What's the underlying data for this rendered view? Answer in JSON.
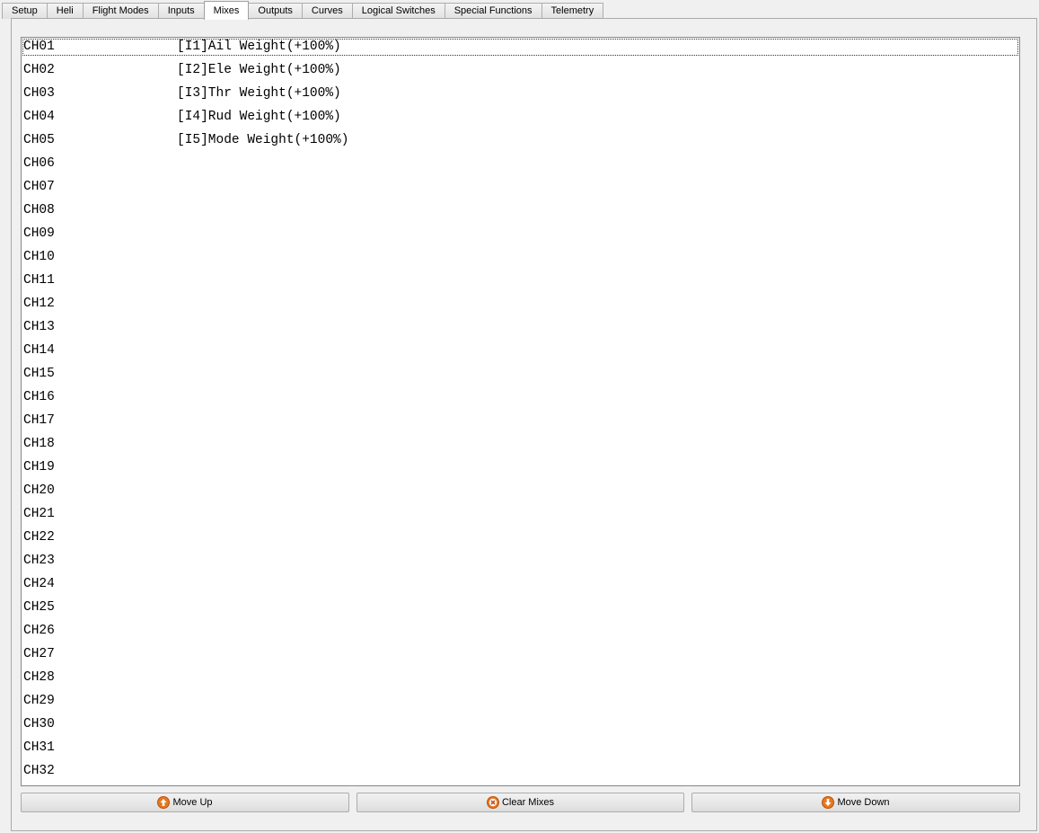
{
  "tabs": [
    "Setup",
    "Heli",
    "Flight Modes",
    "Inputs",
    "Mixes",
    "Outputs",
    "Curves",
    "Logical Switches",
    "Special Functions",
    "Telemetry"
  ],
  "active_tab": "Mixes",
  "mixes": [
    {
      "channel": "CH01",
      "mix": "[I1]Ail Weight(+100%)"
    },
    {
      "channel": "CH02",
      "mix": "[I2]Ele Weight(+100%)"
    },
    {
      "channel": "CH03",
      "mix": "[I3]Thr Weight(+100%)"
    },
    {
      "channel": "CH04",
      "mix": "[I4]Rud Weight(+100%)"
    },
    {
      "channel": "CH05",
      "mix": "[I5]Mode Weight(+100%)"
    },
    {
      "channel": "CH06",
      "mix": ""
    },
    {
      "channel": "CH07",
      "mix": ""
    },
    {
      "channel": "CH08",
      "mix": ""
    },
    {
      "channel": "CH09",
      "mix": ""
    },
    {
      "channel": "CH10",
      "mix": ""
    },
    {
      "channel": "CH11",
      "mix": ""
    },
    {
      "channel": "CH12",
      "mix": ""
    },
    {
      "channel": "CH13",
      "mix": ""
    },
    {
      "channel": "CH14",
      "mix": ""
    },
    {
      "channel": "CH15",
      "mix": ""
    },
    {
      "channel": "CH16",
      "mix": ""
    },
    {
      "channel": "CH17",
      "mix": ""
    },
    {
      "channel": "CH18",
      "mix": ""
    },
    {
      "channel": "CH19",
      "mix": ""
    },
    {
      "channel": "CH20",
      "mix": ""
    },
    {
      "channel": "CH21",
      "mix": ""
    },
    {
      "channel": "CH22",
      "mix": ""
    },
    {
      "channel": "CH23",
      "mix": ""
    },
    {
      "channel": "CH24",
      "mix": ""
    },
    {
      "channel": "CH25",
      "mix": ""
    },
    {
      "channel": "CH26",
      "mix": ""
    },
    {
      "channel": "CH27",
      "mix": ""
    },
    {
      "channel": "CH28",
      "mix": ""
    },
    {
      "channel": "CH29",
      "mix": ""
    },
    {
      "channel": "CH30",
      "mix": ""
    },
    {
      "channel": "CH31",
      "mix": ""
    },
    {
      "channel": "CH32",
      "mix": ""
    }
  ],
  "buttons": {
    "move_up": {
      "label": "Move Up",
      "icon": "arrow-up-icon"
    },
    "clear": {
      "label": "Clear Mixes",
      "icon": "clear-icon"
    },
    "move_down": {
      "label": "Move Down",
      "icon": "arrow-down-icon"
    }
  },
  "colors": {
    "icon_orange": "#e8771e"
  }
}
